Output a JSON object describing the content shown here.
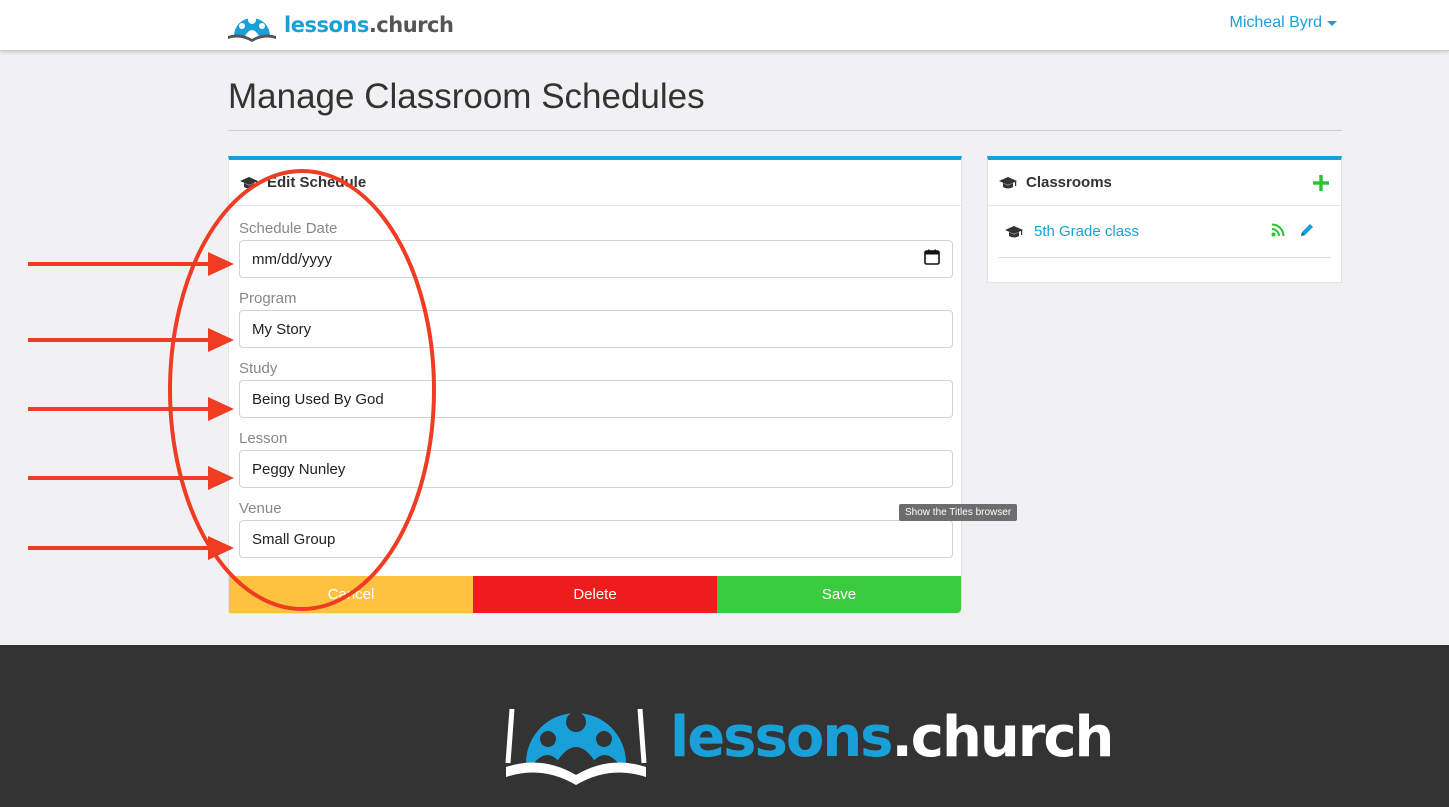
{
  "header": {
    "brand_part1": "lessons",
    "brand_part2": ".church",
    "user_name": "Micheal Byrd"
  },
  "page": {
    "title": "Manage Classroom Schedules"
  },
  "edit_schedule": {
    "heading": "Edit Schedule",
    "fields": {
      "date": {
        "label": "Schedule Date",
        "value": "mm/dd/yyyy"
      },
      "program": {
        "label": "Program",
        "value": "My Story"
      },
      "study": {
        "label": "Study",
        "value": "Being Used By God"
      },
      "lesson": {
        "label": "Lesson",
        "value": "Peggy Nunley"
      },
      "venue": {
        "label": "Venue",
        "value": "Small Group"
      }
    },
    "buttons": {
      "cancel": "Cancel",
      "delete": "Delete",
      "save": "Save"
    }
  },
  "classrooms": {
    "heading": "Classrooms",
    "items": [
      {
        "name": "5th Grade class"
      }
    ]
  },
  "tooltip": "Show the Titles browser",
  "footer": {
    "brand_part1": "lessons",
    "brand_part2": ".church"
  },
  "colors": {
    "accent": "#1aa0d9",
    "cancel": "#fcc240",
    "delete": "#ee1c1c",
    "save": "#3bcb3f",
    "annotation": "#f03c22",
    "footer_bg": "#333333"
  },
  "icons": [
    "logo-icon",
    "mortarboard-icon",
    "calendar-icon",
    "plus-icon",
    "rss-icon",
    "pencil-icon"
  ]
}
